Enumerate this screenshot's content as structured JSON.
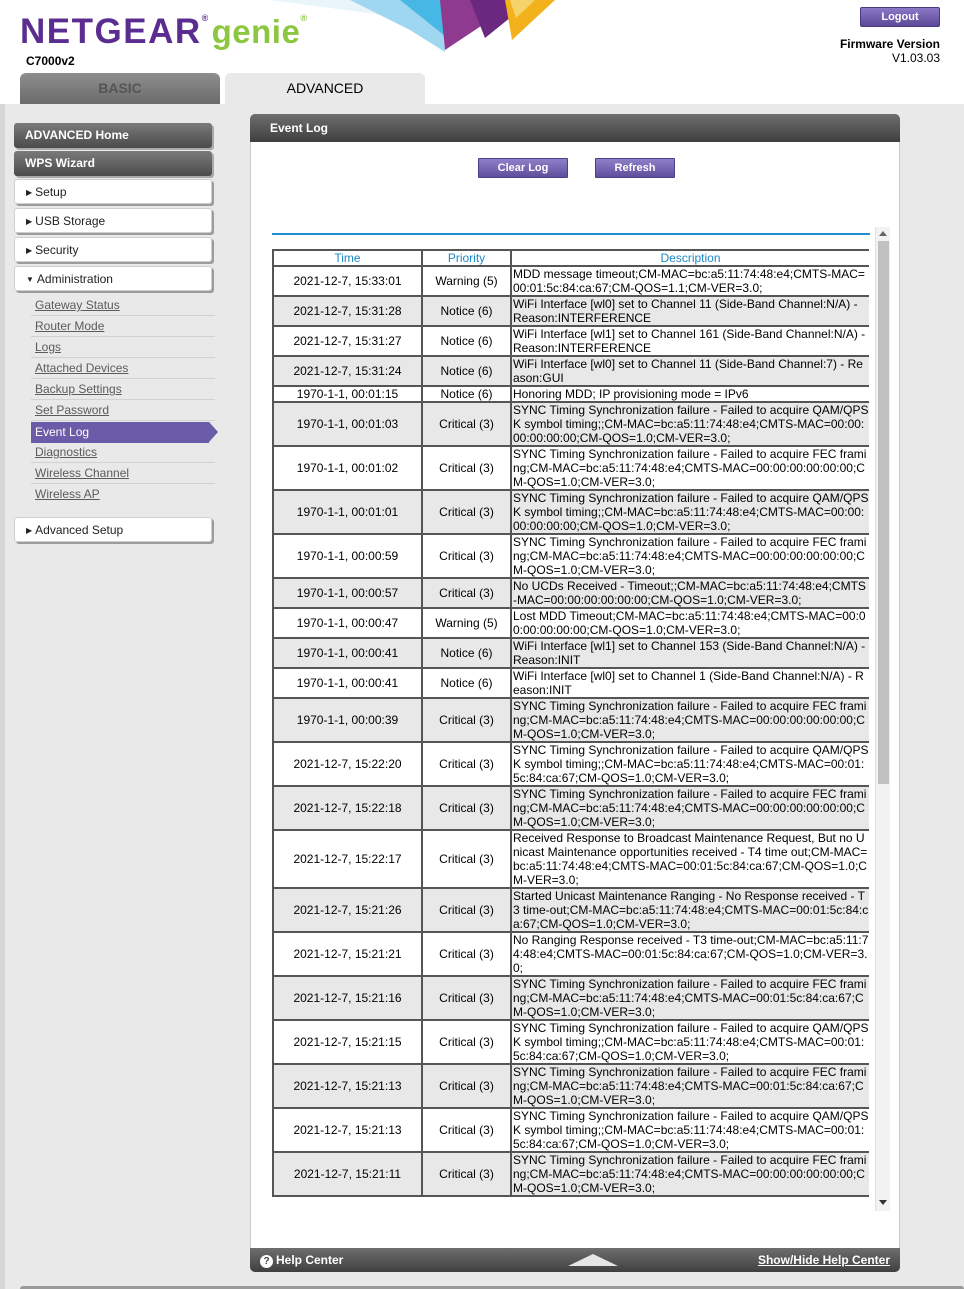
{
  "header": {
    "brand_main": "NETGEAR",
    "brand_sub": "genie",
    "model": "C7000v2",
    "logout_label": "Logout",
    "firmware_label": "Firmware Version",
    "firmware_version": "V1.03.03"
  },
  "tabs": {
    "basic": "BASIC",
    "advanced": "ADVANCED"
  },
  "sidebar": {
    "advanced_home": "ADVANCED Home",
    "wps_wizard": "WPS Wizard",
    "setup": "Setup",
    "usb_storage": "USB Storage",
    "security": "Security",
    "administration": "Administration",
    "admin_items": [
      "Gateway Status",
      "Router Mode",
      "Logs",
      "Attached Devices",
      "Backup Settings",
      "Set Password",
      "Event Log",
      "Diagnostics",
      "Wireless Channel",
      "Wireless AP"
    ],
    "active_item": "Event Log",
    "advanced_setup": "Advanced Setup"
  },
  "panel": {
    "title": "Event Log",
    "clear_log": "Clear Log",
    "refresh": "Refresh"
  },
  "log_table": {
    "headers": [
      "Time",
      "Priority",
      "Description"
    ],
    "rows": [
      {
        "time": "2021-12-7, 15:33:01",
        "priority": "Warning (5)",
        "description": "MDD message timeout;CM-MAC=bc:a5:11:74:48:e4;CMTS-MAC=00:01:5c:84:ca:67;CM-QOS=1.1;CM-VER=3.0;"
      },
      {
        "time": "2021-12-7, 15:31:28",
        "priority": "Notice (6)",
        "description": "WiFi Interface [wl0] set to Channel 11 (Side-Band Channel:N/A) - Reason:INTERFERENCE"
      },
      {
        "time": "2021-12-7, 15:31:27",
        "priority": "Notice (6)",
        "description": "WiFi Interface [wl1] set to Channel 161 (Side-Band Channel:N/A) - Reason:INTERFERENCE"
      },
      {
        "time": "2021-12-7, 15:31:24",
        "priority": "Notice (6)",
        "description": "WiFi Interface [wl0] set to Channel 11 (Side-Band Channel:7) - Reason:GUI"
      },
      {
        "time": "1970-1-1, 00:01:15",
        "priority": "Notice (6)",
        "description": "Honoring MDD; IP provisioning mode = IPv6"
      },
      {
        "time": "1970-1-1, 00:01:03",
        "priority": "Critical (3)",
        "description": "SYNC Timing Synchronization failure - Failed to acquire QAM/QPSK symbol timing;;CM-MAC=bc:a5:11:74:48:e4;CMTS-MAC=00:00:00:00:00:00;CM-QOS=1.0;CM-VER=3.0;"
      },
      {
        "time": "1970-1-1, 00:01:02",
        "priority": "Critical (3)",
        "description": "SYNC Timing Synchronization failure - Failed to acquire FEC framing;CM-MAC=bc:a5:11:74:48:e4;CMTS-MAC=00:00:00:00:00:00;CM-QOS=1.0;CM-VER=3.0;"
      },
      {
        "time": "1970-1-1, 00:01:01",
        "priority": "Critical (3)",
        "description": "SYNC Timing Synchronization failure - Failed to acquire QAM/QPSK symbol timing;;CM-MAC=bc:a5:11:74:48:e4;CMTS-MAC=00:00:00:00:00:00;CM-QOS=1.0;CM-VER=3.0;"
      },
      {
        "time": "1970-1-1, 00:00:59",
        "priority": "Critical (3)",
        "description": "SYNC Timing Synchronization failure - Failed to acquire FEC framing;CM-MAC=bc:a5:11:74:48:e4;CMTS-MAC=00:00:00:00:00:00;CM-QOS=1.0;CM-VER=3.0;"
      },
      {
        "time": "1970-1-1, 00:00:57",
        "priority": "Critical (3)",
        "description": "No UCDs Received - Timeout;;CM-MAC=bc:a5:11:74:48:e4;CMTS-MAC=00:00:00:00:00:00;CM-QOS=1.0;CM-VER=3.0;"
      },
      {
        "time": "1970-1-1, 00:00:47",
        "priority": "Warning (5)",
        "description": "Lost MDD Timeout;CM-MAC=bc:a5:11:74:48:e4;CMTS-MAC=00:00:00:00:00:00;CM-QOS=1.0;CM-VER=3.0;"
      },
      {
        "time": "1970-1-1, 00:00:41",
        "priority": "Notice (6)",
        "description": "WiFi Interface [wl1] set to Channel 153 (Side-Band Channel:N/A) - Reason:INIT"
      },
      {
        "time": "1970-1-1, 00:00:41",
        "priority": "Notice (6)",
        "description": "WiFi Interface [wl0] set to Channel 1 (Side-Band Channel:N/A) - Reason:INIT"
      },
      {
        "time": "1970-1-1, 00:00:39",
        "priority": "Critical (3)",
        "description": "SYNC Timing Synchronization failure - Failed to acquire FEC framing;CM-MAC=bc:a5:11:74:48:e4;CMTS-MAC=00:00:00:00:00:00;CM-QOS=1.0;CM-VER=3.0;"
      },
      {
        "time": "2021-12-7, 15:22:20",
        "priority": "Critical (3)",
        "description": "SYNC Timing Synchronization failure - Failed to acquire QAM/QPSK symbol timing;;CM-MAC=bc:a5:11:74:48:e4;CMTS-MAC=00:01:5c:84:ca:67;CM-QOS=1.0;CM-VER=3.0;"
      },
      {
        "time": "2021-12-7, 15:22:18",
        "priority": "Critical (3)",
        "description": "SYNC Timing Synchronization failure - Failed to acquire FEC framing;CM-MAC=bc:a5:11:74:48:e4;CMTS-MAC=00:00:00:00:00:00;CM-QOS=1.0;CM-VER=3.0;"
      },
      {
        "time": "2021-12-7, 15:22:17",
        "priority": "Critical (3)",
        "description": "Received Response to Broadcast Maintenance Request, But no Unicast Maintenance opportunities received - T4 time out;CM-MAC=bc:a5:11:74:48:e4;CMTS-MAC=00:01:5c:84:ca:67;CM-QOS=1.0;CM-VER=3.0;"
      },
      {
        "time": "2021-12-7, 15:21:26",
        "priority": "Critical (3)",
        "description": "Started Unicast Maintenance Ranging - No Response received - T3 time-out;CM-MAC=bc:a5:11:74:48:e4;CMTS-MAC=00:01:5c:84:ca:67;CM-QOS=1.0;CM-VER=3.0;"
      },
      {
        "time": "2021-12-7, 15:21:21",
        "priority": "Critical (3)",
        "description": "No Ranging Response received - T3 time-out;CM-MAC=bc:a5:11:74:48:e4;CMTS-MAC=00:01:5c:84:ca:67;CM-QOS=1.0;CM-VER=3.0;"
      },
      {
        "time": "2021-12-7, 15:21:16",
        "priority": "Critical (3)",
        "description": "SYNC Timing Synchronization failure - Failed to acquire FEC framing;CM-MAC=bc:a5:11:74:48:e4;CMTS-MAC=00:01:5c:84:ca:67;CM-QOS=1.0;CM-VER=3.0;"
      },
      {
        "time": "2021-12-7, 15:21:15",
        "priority": "Critical (3)",
        "description": "SYNC Timing Synchronization failure - Failed to acquire QAM/QPSK symbol timing;;CM-MAC=bc:a5:11:74:48:e4;CMTS-MAC=00:01:5c:84:ca:67;CM-QOS=1.0;CM-VER=3.0;"
      },
      {
        "time": "2021-12-7, 15:21:13",
        "priority": "Critical (3)",
        "description": "SYNC Timing Synchronization failure - Failed to acquire FEC framing;CM-MAC=bc:a5:11:74:48:e4;CMTS-MAC=00:01:5c:84:ca:67;CM-QOS=1.0;CM-VER=3.0;"
      },
      {
        "time": "2021-12-7, 15:21:13",
        "priority": "Critical (3)",
        "description": "SYNC Timing Synchronization failure - Failed to acquire QAM/QPSK symbol timing;;CM-MAC=bc:a5:11:74:48:e4;CMTS-MAC=00:01:5c:84:ca:67;CM-QOS=1.0;CM-VER=3.0;"
      },
      {
        "time": "2021-12-7, 15:21:11",
        "priority": "Critical (3)",
        "description": "SYNC Timing Synchronization failure - Failed to acquire FEC framing;CM-MAC=bc:a5:11:74:48:e4;CMTS-MAC=00:00:00:00:00:00;CM-QOS=1.0;CM-VER=3.0;"
      }
    ]
  },
  "footer": {
    "help_center": "Help Center",
    "show_hide": "Show/Hide Help Center"
  },
  "colors": {
    "brand_purple": "#5c2d91",
    "brand_green": "#8dc63f",
    "button_purple": "#6b5ca9",
    "header_link_blue": "#1e88c7"
  },
  "icons": [
    "help-icon",
    "collapse-arrow-icon",
    "menu-arrow-icon"
  ]
}
